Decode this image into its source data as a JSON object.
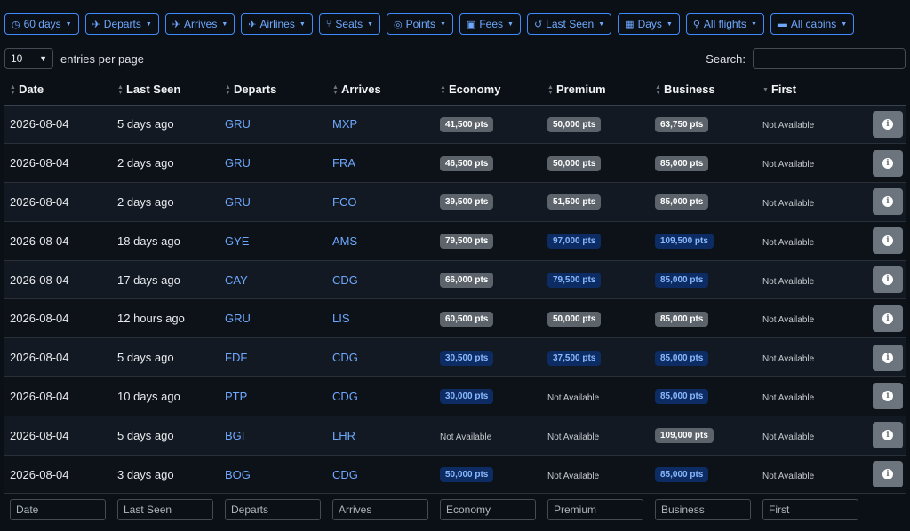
{
  "filters": [
    {
      "icon": "clock-icon",
      "glyph": "◷",
      "label": "60 days"
    },
    {
      "icon": "plane-departure-icon",
      "glyph": "✈",
      "label": "Departs"
    },
    {
      "icon": "plane-arrival-icon",
      "glyph": "✈",
      "label": "Arrives"
    },
    {
      "icon": "plane-icon",
      "glyph": "✈",
      "label": "Airlines"
    },
    {
      "icon": "seat-icon",
      "glyph": "⑂",
      "label": "Seats"
    },
    {
      "icon": "coins-icon",
      "glyph": "◎",
      "label": "Points"
    },
    {
      "icon": "money-bill-icon",
      "glyph": "▣",
      "label": "Fees"
    },
    {
      "icon": "history-icon",
      "glyph": "↺",
      "label": "Last Seen"
    },
    {
      "icon": "calendar-icon",
      "glyph": "▦",
      "label": "Days"
    },
    {
      "icon": "route-icon",
      "glyph": "⚲",
      "label": "All flights"
    },
    {
      "icon": "couch-icon",
      "glyph": "▬",
      "label": "All cabins"
    }
  ],
  "length_control": {
    "value": "10",
    "label": "entries per page"
  },
  "search": {
    "label": "Search:",
    "value": ""
  },
  "columns": [
    "Date",
    "Last Seen",
    "Departs",
    "Arrives",
    "Economy",
    "Premium",
    "Business",
    "First"
  ],
  "rows": [
    {
      "date": "2026-08-04",
      "last_seen": "5 days ago",
      "departs": "GRU",
      "arrives": "MXP",
      "economy": {
        "text": "41,500 pts",
        "style": "gray"
      },
      "premium": {
        "text": "50,000 pts",
        "style": "gray"
      },
      "business": {
        "text": "63,750 pts",
        "style": "gray"
      },
      "first": {
        "text": "Not Available",
        "style": "na"
      }
    },
    {
      "date": "2026-08-04",
      "last_seen": "2 days ago",
      "departs": "GRU",
      "arrives": "FRA",
      "economy": {
        "text": "46,500 pts",
        "style": "gray"
      },
      "premium": {
        "text": "50,000 pts",
        "style": "gray"
      },
      "business": {
        "text": "85,000 pts",
        "style": "gray"
      },
      "first": {
        "text": "Not Available",
        "style": "na"
      }
    },
    {
      "date": "2026-08-04",
      "last_seen": "2 days ago",
      "departs": "GRU",
      "arrives": "FCO",
      "economy": {
        "text": "39,500 pts",
        "style": "gray"
      },
      "premium": {
        "text": "51,500 pts",
        "style": "gray"
      },
      "business": {
        "text": "85,000 pts",
        "style": "gray"
      },
      "first": {
        "text": "Not Available",
        "style": "na"
      }
    },
    {
      "date": "2026-08-04",
      "last_seen": "18 days ago",
      "departs": "GYE",
      "arrives": "AMS",
      "economy": {
        "text": "79,500 pts",
        "style": "gray"
      },
      "premium": {
        "text": "97,000 pts",
        "style": "blue"
      },
      "business": {
        "text": "109,500 pts",
        "style": "blue"
      },
      "first": {
        "text": "Not Available",
        "style": "na"
      }
    },
    {
      "date": "2026-08-04",
      "last_seen": "17 days ago",
      "departs": "CAY",
      "arrives": "CDG",
      "economy": {
        "text": "66,000 pts",
        "style": "gray"
      },
      "premium": {
        "text": "79,500 pts",
        "style": "blue"
      },
      "business": {
        "text": "85,000 pts",
        "style": "blue"
      },
      "first": {
        "text": "Not Available",
        "style": "na"
      }
    },
    {
      "date": "2026-08-04",
      "last_seen": "12 hours ago",
      "departs": "GRU",
      "arrives": "LIS",
      "economy": {
        "text": "60,500 pts",
        "style": "gray"
      },
      "premium": {
        "text": "50,000 pts",
        "style": "gray"
      },
      "business": {
        "text": "85,000 pts",
        "style": "gray"
      },
      "first": {
        "text": "Not Available",
        "style": "na"
      }
    },
    {
      "date": "2026-08-04",
      "last_seen": "5 days ago",
      "departs": "FDF",
      "arrives": "CDG",
      "economy": {
        "text": "30,500 pts",
        "style": "blue"
      },
      "premium": {
        "text": "37,500 pts",
        "style": "blue"
      },
      "business": {
        "text": "85,000 pts",
        "style": "blue"
      },
      "first": {
        "text": "Not Available",
        "style": "na"
      }
    },
    {
      "date": "2026-08-04",
      "last_seen": "10 days ago",
      "departs": "PTP",
      "arrives": "CDG",
      "economy": {
        "text": "30,000 pts",
        "style": "blue"
      },
      "premium": {
        "text": "Not Available",
        "style": "na"
      },
      "business": {
        "text": "85,000 pts",
        "style": "blue"
      },
      "first": {
        "text": "Not Available",
        "style": "na"
      }
    },
    {
      "date": "2026-08-04",
      "last_seen": "5 days ago",
      "departs": "BGI",
      "arrives": "LHR",
      "economy": {
        "text": "Not Available",
        "style": "na"
      },
      "premium": {
        "text": "Not Available",
        "style": "na"
      },
      "business": {
        "text": "109,000 pts",
        "style": "gray"
      },
      "first": {
        "text": "Not Available",
        "style": "na"
      }
    },
    {
      "date": "2026-08-04",
      "last_seen": "3 days ago",
      "departs": "BOG",
      "arrives": "CDG",
      "economy": {
        "text": "50,000 pts",
        "style": "blue"
      },
      "premium": {
        "text": "Not Available",
        "style": "na"
      },
      "business": {
        "text": "85,000 pts",
        "style": "blue"
      },
      "first": {
        "text": "Not Available",
        "style": "na"
      }
    }
  ],
  "footer_filters": [
    "Date",
    "Last Seen",
    "Departs",
    "Arrives",
    "Economy",
    "Premium",
    "Business",
    "First"
  ],
  "info_glyph": "i",
  "colors": {
    "accent": "#3d8bfd",
    "badge_gray": "#5c636a",
    "badge_blue": "#0c2c63"
  }
}
